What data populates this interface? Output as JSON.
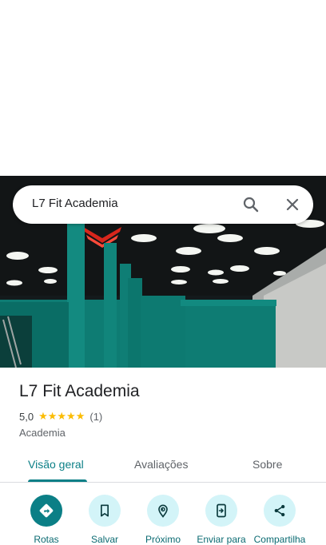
{
  "search": {
    "query": "L7 Fit Academia"
  },
  "place": {
    "name": "L7 Fit Academia",
    "rating": "5,0",
    "stars": "★★★★★",
    "review_count": "(1)",
    "category": "Academia"
  },
  "tabs": [
    {
      "label": "Visão geral",
      "active": true
    },
    {
      "label": "Avaliações",
      "active": false
    },
    {
      "label": "Sobre",
      "active": false
    }
  ],
  "actions": [
    {
      "label": "Rotas",
      "icon": "directions-icon"
    },
    {
      "label": "Salvar",
      "icon": "bookmark-icon"
    },
    {
      "label": "Próximo",
      "icon": "nearby-icon"
    },
    {
      "label": "Enviar para",
      "icon": "send-to-phone-icon"
    },
    {
      "label": "Compartilha",
      "icon": "share-icon"
    }
  ],
  "colors": {
    "accent": "#0b7f86",
    "action_bg": "#d3f4f8",
    "star": "#fbbc04"
  }
}
